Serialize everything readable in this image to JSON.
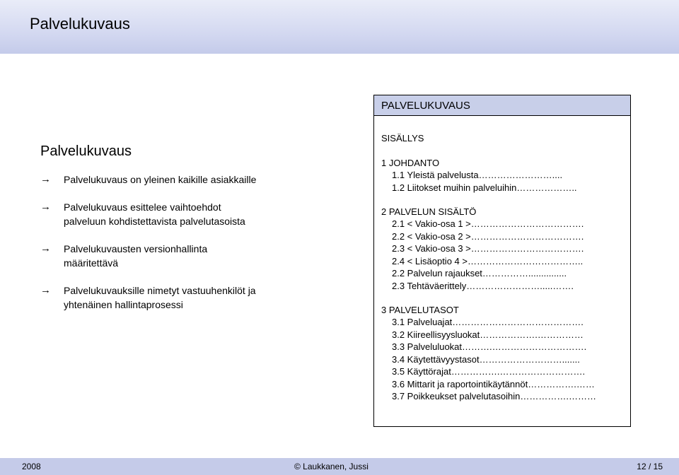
{
  "slide": {
    "title": "Palvelukuvaus"
  },
  "left": {
    "title": "Palvelukuvaus",
    "bullet_icon": "right-arrow-icon",
    "bullets": [
      {
        "line1": "Palvelukuvaus on yleinen kaikille asiakkaille",
        "line2": ""
      },
      {
        "line1": "Palvelukuvaus esittelee vaihtoehdot",
        "line2": "palveluun kohdistettavista palvelutasoista"
      },
      {
        "line1": "Palvelukuvausten versionhallinta",
        "line2": "määritettävä"
      },
      {
        "line1": "Palvelukuvauksille nimetyt vastuuhenkilöt ja",
        "line2": "yhtenäinen hallintaprosessi"
      }
    ]
  },
  "toc": {
    "header": "PALVELUKUVAUS",
    "heading": "SISÄLLYS",
    "sections": [
      {
        "title": "1 JOHDANTO",
        "items": [
          "1.1  Yleistä palvelusta……………………....",
          "1.2  Liitokset muihin palveluihin……………….."
        ]
      },
      {
        "title": "2 PALVELUN SISÄLTÖ",
        "items": [
          "2.1  < Vakio-osa 1 >……………………………….",
          "2.2  < Vakio-osa 2 >……………………………….",
          "2.3  < Vakio-osa 3 >……………………………….",
          "2.4  < Lisäoptio 4 >………………………………..",
          "2.2  Palvelun rajaukset……………...............",
          "2.3  Tehtäväerittely…………………….....……."
        ]
      },
      {
        "title": "3 PALVELUTASOT",
        "items": [
          "3.1  Palveluajat…………………………………….",
          "3.2  Kiireellisyysluokat……………….……………",
          "3.3  Palveluluokat……….………………………….",
          "3.4  Käytettävyystasot……………………….......",
          "3.5  Käyttörajat…………….……………………….",
          "3.6  Mittarit ja raportointikäytännöt…………….……",
          "3.7  Poikkeukset palvelutasoihin…………….………"
        ]
      }
    ]
  },
  "footer": {
    "year": "2008",
    "author": "© Laukkanen, Jussi",
    "page": "12 / 15"
  }
}
